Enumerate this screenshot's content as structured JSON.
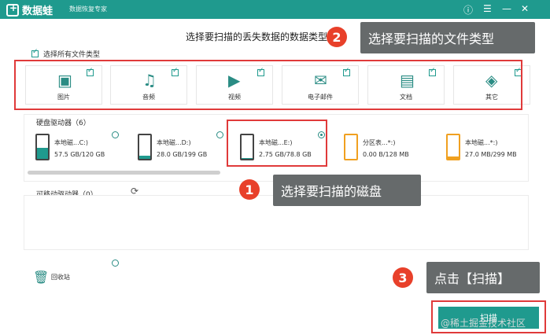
{
  "titlebar": {
    "app_name": "数据蛙",
    "subtitle": "数据恢复专家",
    "icons": [
      "help-icon",
      "menu-icon",
      "minimize-icon",
      "close-icon"
    ]
  },
  "header": {
    "prompt": "选择要扫描的丢失数据的数据类型",
    "select_all_label": "选择所有文件类型"
  },
  "file_types": [
    {
      "label": "图片",
      "icon": "image-icon",
      "checked": true
    },
    {
      "label": "音频",
      "icon": "music-icon",
      "checked": true
    },
    {
      "label": "视频",
      "icon": "video-icon",
      "checked": true
    },
    {
      "label": "电子邮件",
      "icon": "email-icon",
      "checked": true
    },
    {
      "label": "文档",
      "icon": "document-icon",
      "checked": true
    },
    {
      "label": "其它",
      "icon": "other-icon",
      "checked": true
    }
  ],
  "hard_drives": {
    "title": "硬盘驱动器（6）",
    "items": [
      {
        "name": "本地磁...C:)",
        "size": "57.5 GB/120 GB",
        "selected": false,
        "fill": 0.48
      },
      {
        "name": "本地磁...D:)",
        "size": "28.0 GB/199 GB",
        "selected": false,
        "fill": 0.14
      },
      {
        "name": "本地磁...E:)",
        "size": "2.75 GB/78.8 GB",
        "selected": true,
        "fill": 0.03
      },
      {
        "name": "分区表...*:)",
        "size": "0.00  B/128 MB",
        "selected": false,
        "fill": 0.0
      },
      {
        "name": "本地磁...*:)",
        "size": "27.0 MB/299 MB",
        "selected": false,
        "fill": 0.09
      }
    ]
  },
  "removable": {
    "title": "可移动驱动器（0）"
  },
  "recycle_bin": {
    "label": "回收站"
  },
  "scan_button": {
    "label": "扫描"
  },
  "annotations": {
    "step1": {
      "num": "1",
      "text": "选择要扫描的磁盘"
    },
    "step2": {
      "num": "2",
      "text": "选择要扫描的文件类型"
    },
    "step3": {
      "num": "3",
      "text": "点击【扫描】"
    }
  },
  "watermark": "@稀土掘金技术社区",
  "colors": {
    "accent": "#1f9a8e",
    "callout": "#666a6b",
    "badge": "#e8402a",
    "highlight": "#e03a3a"
  }
}
